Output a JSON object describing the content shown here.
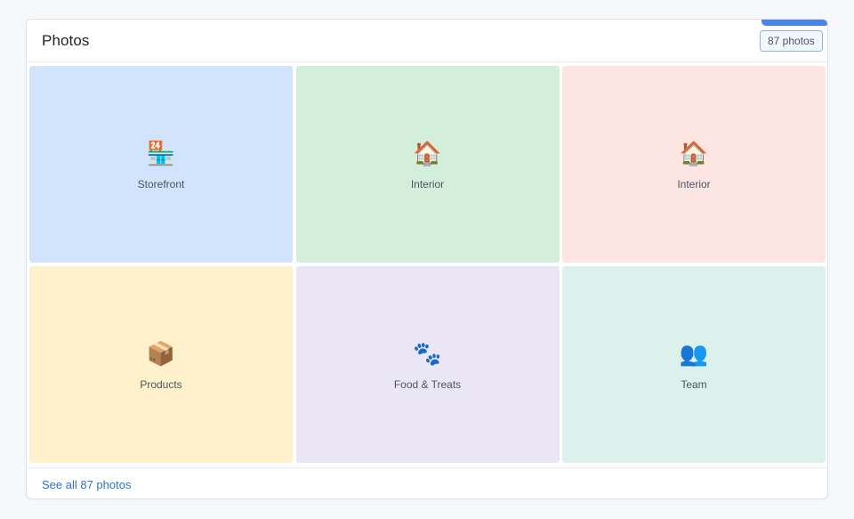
{
  "card": {
    "title": "Photos",
    "count_badge": "87 photos",
    "footer_link": "See all 87 photos"
  },
  "tiles": [
    {
      "label": "Storefront",
      "icon": "storefront-icon",
      "glyph": "🏪",
      "bg": "#d2e3fc"
    },
    {
      "label": "Interior",
      "icon": "house-icon",
      "glyph": "🏠",
      "bg": "#d4eedc"
    },
    {
      "label": "Interior",
      "icon": "house-icon",
      "glyph": "🏠",
      "bg": "#fde5e4"
    },
    {
      "label": "Products",
      "icon": "package-icon",
      "glyph": "📦",
      "bg": "#fef1cc"
    },
    {
      "label": "Food & Treats",
      "icon": "paw-prints-icon",
      "glyph": "🐾",
      "bg": "#ebe6f6"
    },
    {
      "label": "Team",
      "icon": "people-icon",
      "glyph": "👥",
      "bg": "#dcf1ec"
    }
  ],
  "colors": {
    "accent": "#4a86e8",
    "link": "#2f72c9"
  }
}
